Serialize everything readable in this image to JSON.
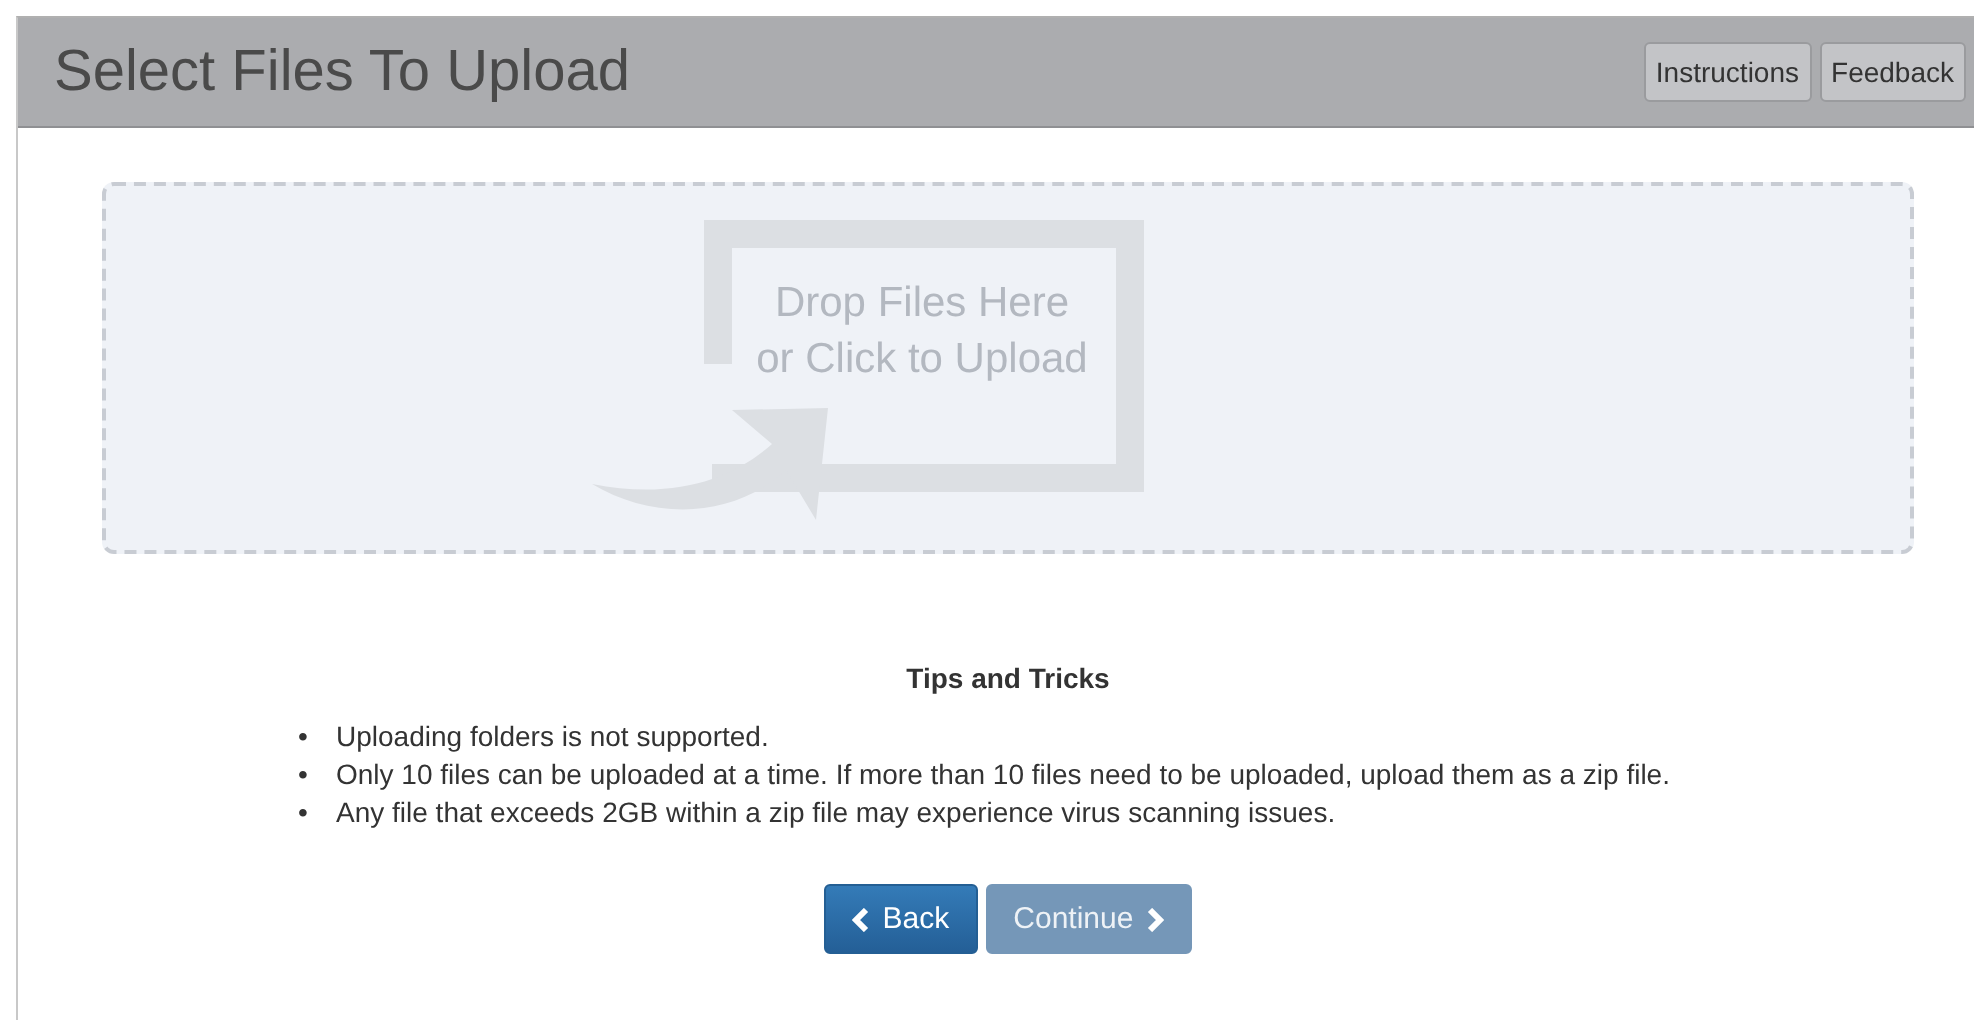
{
  "header": {
    "title": "Select Files To Upload",
    "buttons": [
      "Instructions",
      "Feedback"
    ]
  },
  "drop_zone": {
    "lines": [
      "Drop Files Here",
      "or Click to Upload"
    ]
  },
  "tips": {
    "title": "Tips and Tricks",
    "items": [
      {
        "bullet": "•",
        "text": "Uploading folders is not supported."
      },
      {
        "bullet": "•",
        "text": "Only 10 files can be uploaded at a time. If more than 10 files need to be uploaded, upload them as a zip file."
      },
      {
        "bullet": "•",
        "text": "Any file that exceeds 2GB within a zip file may experience virus scanning issues."
      }
    ]
  },
  "actions": [
    {
      "label": "Back",
      "kind": "back",
      "disabled": false
    },
    {
      "label": "Continue",
      "kind": "next",
      "disabled": true
    }
  ]
}
